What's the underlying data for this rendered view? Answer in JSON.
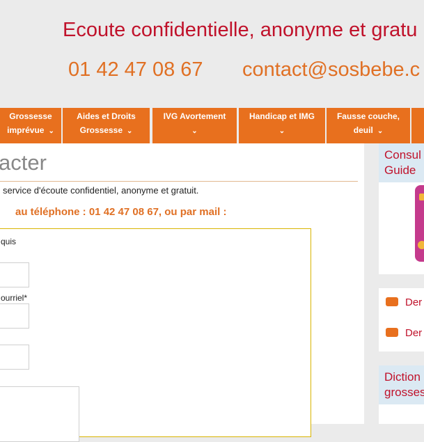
{
  "header": {
    "tagline": "Ecoute confidentielle, anonyme et gratu",
    "phone": "01 42 47 08 67",
    "email": "contact@sosbebe.c"
  },
  "nav": {
    "items": [
      {
        "line1": "Grossesse",
        "line2": "imprévue"
      },
      {
        "line1": "Aides et Droits",
        "line2": "Grossesse"
      },
      {
        "line1": "IVG Avortement",
        "line2": ""
      },
      {
        "line1": "Handicap et IMG",
        "line2": ""
      },
      {
        "line1": "Fausse couche,",
        "line2": "deuil"
      },
      {
        "line1": "",
        "line2": ""
      }
    ]
  },
  "main": {
    "title": "acter",
    "intro": " service d'écoute confidentiel, anonyme et gratuit.",
    "contact_line": "au téléphone : 01 42 47 08 67, ou par mail :",
    "form": {
      "label_required": "quis",
      "label_email": "ourriel*"
    }
  },
  "sidebar": {
    "widget1_title_line1": "Consul",
    "widget1_title_line2": "Guide",
    "list": [
      "Der",
      "Der"
    ],
    "widget3_title_line1": "Diction",
    "widget3_title_line2": "grosses"
  },
  "colors": {
    "accent_red": "#c0122b",
    "accent_orange": "#e07024",
    "nav_orange": "#e8701e",
    "sidebar_head": "#dbe9f3"
  }
}
